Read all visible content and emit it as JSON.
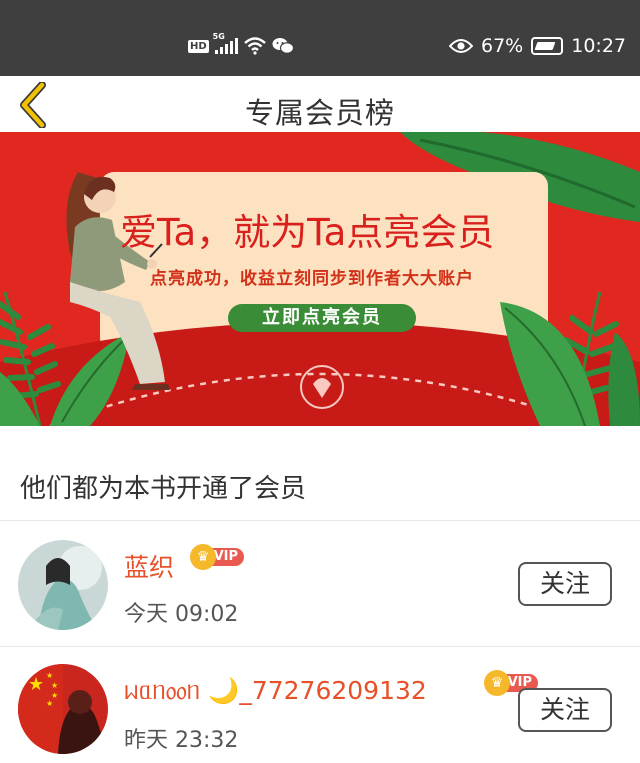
{
  "status_bar": {
    "hd": "HD",
    "network": "5G",
    "eye_icon": "eye-icon",
    "battery_percent": "67%",
    "time": "10:27"
  },
  "header": {
    "title": "专属会员榜",
    "back_icon": "chevron-left-icon",
    "accent_color": "#f2c200"
  },
  "banner": {
    "headline": "爱Ta，就为Ta点亮会员",
    "subline": "点亮成功，收益立刻同步到作者大大账户",
    "button_label": "立即点亮会员",
    "colors": {
      "background": "#e02820",
      "card": "#fde2c2",
      "button": "#3a8c36"
    }
  },
  "section": {
    "title": "他们都为本书开通了会员"
  },
  "members": [
    {
      "name": "蓝织",
      "vip_label": "VIP",
      "time": "今天 09:02",
      "follow_label": "关注"
    },
    {
      "name": "ᥕᥲᥒ᥆᥆ᥒ 🌙_77276209132",
      "vip_label": "VIP",
      "time": "昨天 23:32",
      "follow_label": "关注"
    }
  ]
}
